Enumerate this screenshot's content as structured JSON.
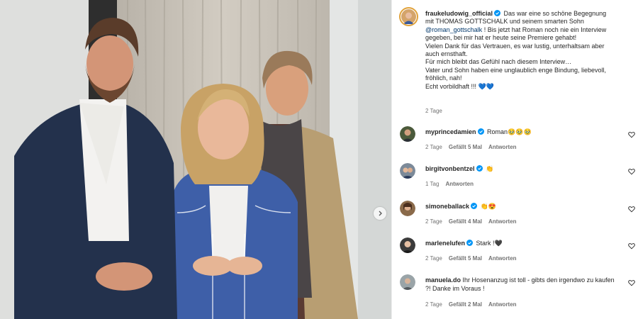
{
  "post": {
    "username": "fraukeludowig_official",
    "caption_lines": [
      "Das war eine so schöne Begegnung",
      "mit THOMAS GOTTSCHALK und seinem smarten Sohn",
      "@roman_gottschalk",
      " ! Bis jetzt hat Roman noch nie ein Interview",
      "gegeben, bei mir hat er heute seine Premiere gehabt!",
      "Vielen Dank für das Vertrauen, es war lustig, unterhaltsam aber",
      "auch ernsthaft.",
      "Für mich bleibt das Gefühl nach diesem Interview…",
      "Vater und Sohn haben eine unglaublich enge Bindung, liebevoll,",
      "fröhlich, nah!",
      "Echt vorbildhaft !!! 💙💙"
    ],
    "time": "2 Tage"
  },
  "comments": [
    {
      "user": "myprincedamien",
      "verified": true,
      "text": "Roman🥹🥹🥹",
      "time": "2 Tage",
      "likes": "Gefällt 5 Mal",
      "reply": "Antworten"
    },
    {
      "user": "birgitvonbentzel",
      "verified": true,
      "text": "👏",
      "time": "1 Tag",
      "likes": "",
      "reply": "Antworten"
    },
    {
      "user": "simoneballack",
      "verified": true,
      "text": "👏😍",
      "time": "2 Tage",
      "likes": "Gefällt 4 Mal",
      "reply": "Antworten"
    },
    {
      "user": "marlenelufen",
      "verified": true,
      "text": "Stark !🖤",
      "time": "2 Tage",
      "likes": "Gefällt 5 Mal",
      "reply": "Antworten"
    },
    {
      "user": "manuela.do",
      "verified": false,
      "text": "Ihr Hosenanzug ist toll - gibts den irgendwo zu kaufen ?! Danke im Voraus !",
      "time": "2 Tage",
      "likes": "Gefällt 2 Mal",
      "reply": "Antworten"
    }
  ],
  "colors": {
    "accent": "#0095f6",
    "verified": "#0095f6",
    "link": "#00376b",
    "meta": "#737373"
  },
  "icons": {
    "next": "chevron-right-icon",
    "like": "heart-outline-icon",
    "badge": "verified-badge-icon"
  }
}
